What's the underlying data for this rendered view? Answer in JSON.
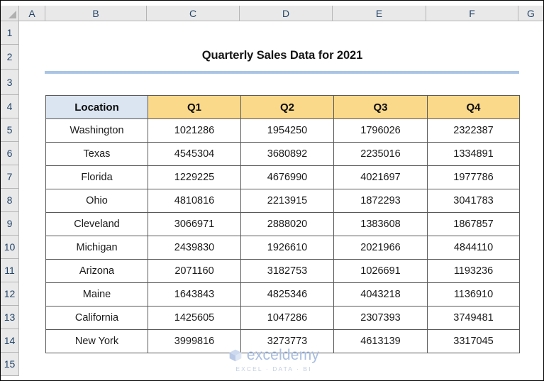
{
  "spreadsheet": {
    "column_headers": [
      "A",
      "B",
      "C",
      "D",
      "E",
      "F",
      "G"
    ],
    "row_headers": [
      "1",
      "2",
      "3",
      "4",
      "5",
      "6",
      "7",
      "8",
      "9",
      "10",
      "11",
      "12",
      "13",
      "14",
      "15"
    ],
    "select_all_icon": "select-all-triangle-icon"
  },
  "title": {
    "text": "Quarterly Sales Data for 2021",
    "rule_color": "#a9c4e4"
  },
  "table": {
    "headers": [
      "Location",
      "Q1",
      "Q2",
      "Q3",
      "Q4"
    ],
    "header_colors": {
      "location": "#dbe5f1",
      "quarter": "#fbd98b"
    },
    "rows": [
      {
        "location": "Washington",
        "q1": "1021286",
        "q2": "1954250",
        "q3": "1796026",
        "q4": "2322387"
      },
      {
        "location": "Texas",
        "q1": "4545304",
        "q2": "3680892",
        "q3": "2235016",
        "q4": "1334891"
      },
      {
        "location": "Florida",
        "q1": "1229225",
        "q2": "4676990",
        "q3": "4021697",
        "q4": "1977786"
      },
      {
        "location": "Ohio",
        "q1": "4810816",
        "q2": "2213915",
        "q3": "1872293",
        "q4": "3041783"
      },
      {
        "location": "Cleveland",
        "q1": "3066971",
        "q2": "2888020",
        "q3": "1383608",
        "q4": "1867857"
      },
      {
        "location": "Michigan",
        "q1": "2439830",
        "q2": "1926610",
        "q3": "2021966",
        "q4": "4844110"
      },
      {
        "location": "Arizona",
        "q1": "2071160",
        "q2": "3182753",
        "q3": "1026691",
        "q4": "1193236"
      },
      {
        "location": "Maine",
        "q1": "1643843",
        "q2": "4825346",
        "q3": "4043218",
        "q4": "1136910"
      },
      {
        "location": "California",
        "q1": "1425605",
        "q2": "1047286",
        "q3": "2307393",
        "q4": "3749481"
      },
      {
        "location": "New York",
        "q1": "3999816",
        "q2": "3273773",
        "q3": "4613139",
        "q4": "3317045"
      }
    ]
  },
  "watermark": {
    "brand": "exceldemy",
    "tagline": "EXCEL · DATA · BI",
    "logo_icon": "cube-logo-icon",
    "color": "#a8bde0"
  }
}
